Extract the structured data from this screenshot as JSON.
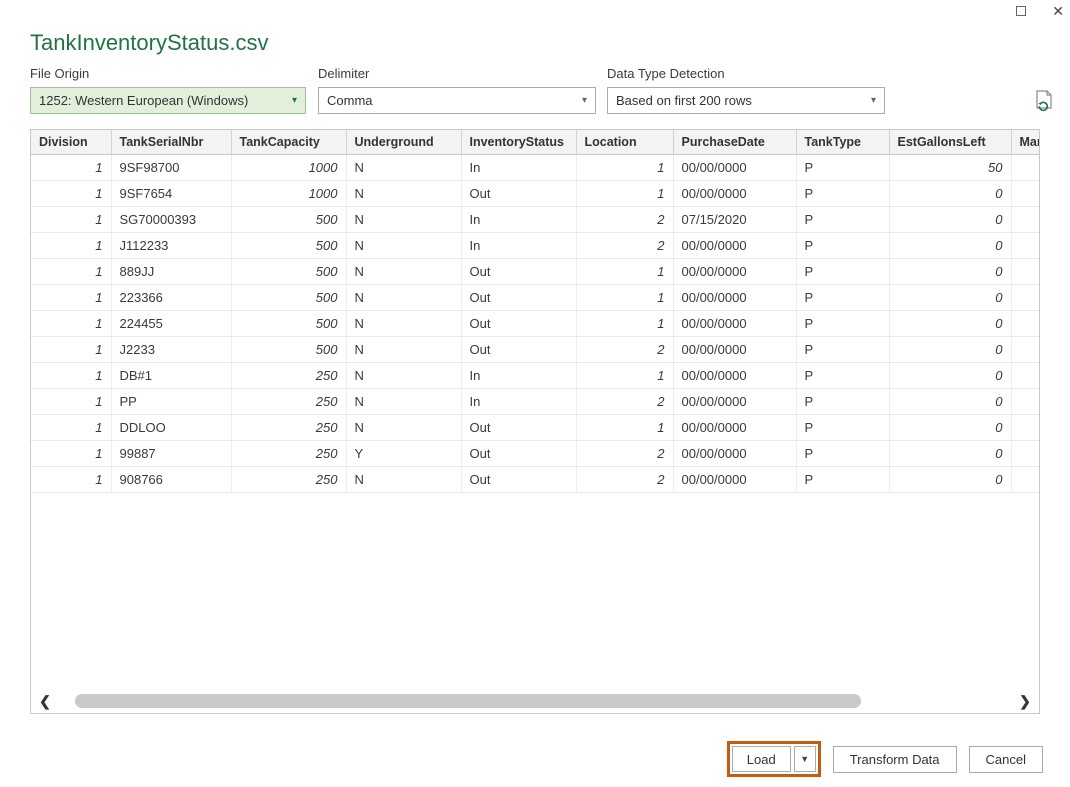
{
  "window": {
    "title": "TankInventoryStatus.csv",
    "close_glyph": "✕"
  },
  "controls": {
    "file_origin": {
      "label": "File Origin",
      "value": "1252: Western European (Windows)"
    },
    "delimiter": {
      "label": "Delimiter",
      "value": "Comma"
    },
    "data_type_detection": {
      "label": "Data Type Detection",
      "value": "Based on first 200 rows"
    },
    "dropdown_arrow": "▾"
  },
  "table": {
    "columns": [
      "Division",
      "TankSerialNbr",
      "TankCapacity",
      "Underground",
      "InventoryStatus",
      "Location",
      "PurchaseDate",
      "TankType",
      "EstGallonsLeft",
      "Man"
    ],
    "rows": [
      [
        "1",
        "9SF98700",
        "1000",
        "N",
        "In",
        "1",
        "00/00/0000",
        "P",
        "50",
        ""
      ],
      [
        "1",
        "9SF7654",
        "1000",
        "N",
        "Out",
        "1",
        "00/00/0000",
        "P",
        "0",
        ""
      ],
      [
        "1",
        "SG70000393",
        "500",
        "N",
        "In",
        "2",
        "07/15/2020",
        "P",
        "0",
        ""
      ],
      [
        "1",
        "J112233",
        "500",
        "N",
        "In",
        "2",
        "00/00/0000",
        "P",
        "0",
        ""
      ],
      [
        "1",
        "889JJ",
        "500",
        "N",
        "Out",
        "1",
        "00/00/0000",
        "P",
        "0",
        ""
      ],
      [
        "1",
        "223366",
        "500",
        "N",
        "Out",
        "1",
        "00/00/0000",
        "P",
        "0",
        ""
      ],
      [
        "1",
        "224455",
        "500",
        "N",
        "Out",
        "1",
        "00/00/0000",
        "P",
        "0",
        ""
      ],
      [
        "1",
        "J2233",
        "500",
        "N",
        "Out",
        "2",
        "00/00/0000",
        "P",
        "0",
        ""
      ],
      [
        "1",
        "DB#1",
        "250",
        "N",
        "In",
        "1",
        "00/00/0000",
        "P",
        "0",
        ""
      ],
      [
        "1",
        "PP",
        "250",
        "N",
        "In",
        "2",
        "00/00/0000",
        "P",
        "0",
        ""
      ],
      [
        "1",
        "DDLOO",
        "250",
        "N",
        "Out",
        "1",
        "00/00/0000",
        "P",
        "0",
        ""
      ],
      [
        "1",
        "99887",
        "250",
        "Y",
        "Out",
        "2",
        "00/00/0000",
        "P",
        "0",
        ""
      ],
      [
        "1",
        "908766",
        "250",
        "N",
        "Out",
        "2",
        "00/00/0000",
        "P",
        "0",
        ""
      ]
    ]
  },
  "scrollbar": {
    "left_glyph": "❮",
    "right_glyph": "❯"
  },
  "buttons": {
    "load": "Load",
    "load_dropdown_glyph": "▼",
    "transform": "Transform Data",
    "cancel": "Cancel"
  },
  "colors": {
    "title_green": "#217346",
    "file_origin_highlight_bg": "#e2efda",
    "load_highlight_orange": "#c55a11"
  }
}
